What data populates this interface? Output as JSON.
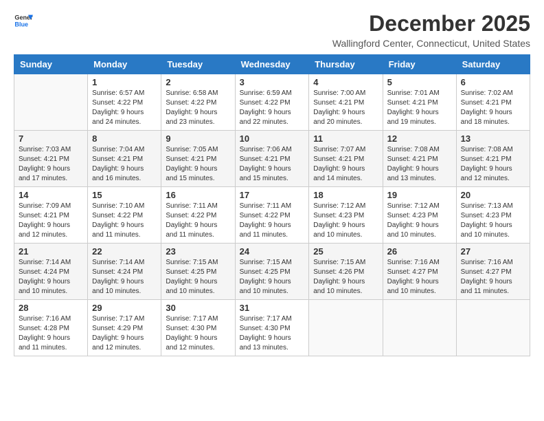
{
  "logo": {
    "line1": "General",
    "line2": "Blue"
  },
  "title": "December 2025",
  "subtitle": "Wallingford Center, Connecticut, United States",
  "days_header": [
    "Sunday",
    "Monday",
    "Tuesday",
    "Wednesday",
    "Thursday",
    "Friday",
    "Saturday"
  ],
  "weeks": [
    [
      {
        "day": "",
        "info": ""
      },
      {
        "day": "1",
        "info": "Sunrise: 6:57 AM\nSunset: 4:22 PM\nDaylight: 9 hours\nand 24 minutes."
      },
      {
        "day": "2",
        "info": "Sunrise: 6:58 AM\nSunset: 4:22 PM\nDaylight: 9 hours\nand 23 minutes."
      },
      {
        "day": "3",
        "info": "Sunrise: 6:59 AM\nSunset: 4:22 PM\nDaylight: 9 hours\nand 22 minutes."
      },
      {
        "day": "4",
        "info": "Sunrise: 7:00 AM\nSunset: 4:21 PM\nDaylight: 9 hours\nand 20 minutes."
      },
      {
        "day": "5",
        "info": "Sunrise: 7:01 AM\nSunset: 4:21 PM\nDaylight: 9 hours\nand 19 minutes."
      },
      {
        "day": "6",
        "info": "Sunrise: 7:02 AM\nSunset: 4:21 PM\nDaylight: 9 hours\nand 18 minutes."
      }
    ],
    [
      {
        "day": "7",
        "info": "Sunrise: 7:03 AM\nSunset: 4:21 PM\nDaylight: 9 hours\nand 17 minutes."
      },
      {
        "day": "8",
        "info": "Sunrise: 7:04 AM\nSunset: 4:21 PM\nDaylight: 9 hours\nand 16 minutes."
      },
      {
        "day": "9",
        "info": "Sunrise: 7:05 AM\nSunset: 4:21 PM\nDaylight: 9 hours\nand 15 minutes."
      },
      {
        "day": "10",
        "info": "Sunrise: 7:06 AM\nSunset: 4:21 PM\nDaylight: 9 hours\nand 15 minutes."
      },
      {
        "day": "11",
        "info": "Sunrise: 7:07 AM\nSunset: 4:21 PM\nDaylight: 9 hours\nand 14 minutes."
      },
      {
        "day": "12",
        "info": "Sunrise: 7:08 AM\nSunset: 4:21 PM\nDaylight: 9 hours\nand 13 minutes."
      },
      {
        "day": "13",
        "info": "Sunrise: 7:08 AM\nSunset: 4:21 PM\nDaylight: 9 hours\nand 12 minutes."
      }
    ],
    [
      {
        "day": "14",
        "info": "Sunrise: 7:09 AM\nSunset: 4:21 PM\nDaylight: 9 hours\nand 12 minutes."
      },
      {
        "day": "15",
        "info": "Sunrise: 7:10 AM\nSunset: 4:22 PM\nDaylight: 9 hours\nand 11 minutes."
      },
      {
        "day": "16",
        "info": "Sunrise: 7:11 AM\nSunset: 4:22 PM\nDaylight: 9 hours\nand 11 minutes."
      },
      {
        "day": "17",
        "info": "Sunrise: 7:11 AM\nSunset: 4:22 PM\nDaylight: 9 hours\nand 11 minutes."
      },
      {
        "day": "18",
        "info": "Sunrise: 7:12 AM\nSunset: 4:23 PM\nDaylight: 9 hours\nand 10 minutes."
      },
      {
        "day": "19",
        "info": "Sunrise: 7:12 AM\nSunset: 4:23 PM\nDaylight: 9 hours\nand 10 minutes."
      },
      {
        "day": "20",
        "info": "Sunrise: 7:13 AM\nSunset: 4:23 PM\nDaylight: 9 hours\nand 10 minutes."
      }
    ],
    [
      {
        "day": "21",
        "info": "Sunrise: 7:14 AM\nSunset: 4:24 PM\nDaylight: 9 hours\nand 10 minutes."
      },
      {
        "day": "22",
        "info": "Sunrise: 7:14 AM\nSunset: 4:24 PM\nDaylight: 9 hours\nand 10 minutes."
      },
      {
        "day": "23",
        "info": "Sunrise: 7:15 AM\nSunset: 4:25 PM\nDaylight: 9 hours\nand 10 minutes."
      },
      {
        "day": "24",
        "info": "Sunrise: 7:15 AM\nSunset: 4:25 PM\nDaylight: 9 hours\nand 10 minutes."
      },
      {
        "day": "25",
        "info": "Sunrise: 7:15 AM\nSunset: 4:26 PM\nDaylight: 9 hours\nand 10 minutes."
      },
      {
        "day": "26",
        "info": "Sunrise: 7:16 AM\nSunset: 4:27 PM\nDaylight: 9 hours\nand 10 minutes."
      },
      {
        "day": "27",
        "info": "Sunrise: 7:16 AM\nSunset: 4:27 PM\nDaylight: 9 hours\nand 11 minutes."
      }
    ],
    [
      {
        "day": "28",
        "info": "Sunrise: 7:16 AM\nSunset: 4:28 PM\nDaylight: 9 hours\nand 11 minutes."
      },
      {
        "day": "29",
        "info": "Sunrise: 7:17 AM\nSunset: 4:29 PM\nDaylight: 9 hours\nand 12 minutes."
      },
      {
        "day": "30",
        "info": "Sunrise: 7:17 AM\nSunset: 4:30 PM\nDaylight: 9 hours\nand 12 minutes."
      },
      {
        "day": "31",
        "info": "Sunrise: 7:17 AM\nSunset: 4:30 PM\nDaylight: 9 hours\nand 13 minutes."
      },
      {
        "day": "",
        "info": ""
      },
      {
        "day": "",
        "info": ""
      },
      {
        "day": "",
        "info": ""
      }
    ]
  ]
}
